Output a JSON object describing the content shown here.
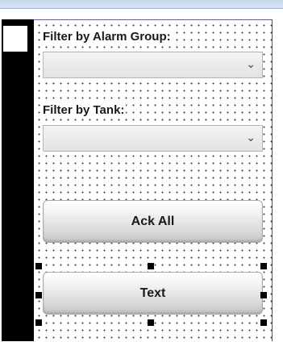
{
  "filters": {
    "alarm_group_label": "Filter by Alarm Group:",
    "alarm_group_value": "",
    "tank_label": "Filter by Tank:",
    "tank_value": ""
  },
  "buttons": {
    "ack_all_label": "Ack All",
    "text_label": "Text"
  },
  "icons": {
    "dropdown": "chevron-down-icon",
    "selection": "resize-handle"
  },
  "colors": {
    "canvas_border": "#3f4aa8",
    "button_bottom": "#c2c2c2",
    "left_panel": "#000000"
  }
}
